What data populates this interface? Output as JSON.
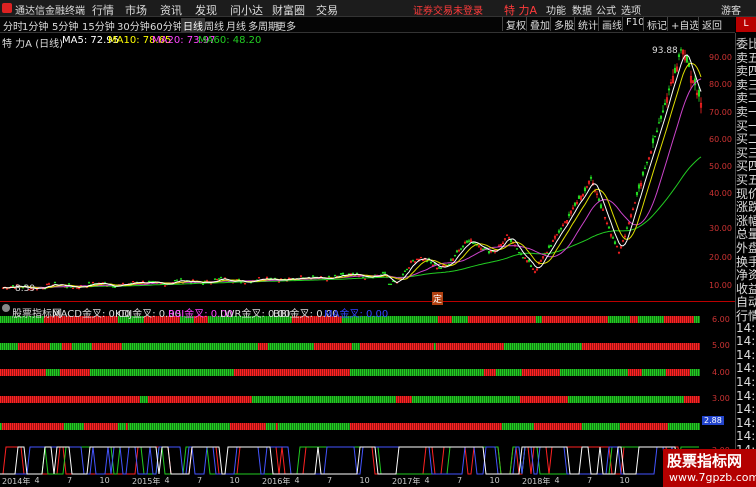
{
  "titlebar": {
    "app_name": "通达信金融终端",
    "menus": [
      "行情",
      "市场",
      "资讯",
      "发现",
      "问小达",
      "财富圈",
      "交易"
    ],
    "login_status": "证券交易未登录",
    "stock_name": "特 力A",
    "right_menus": [
      "功能",
      "数据",
      "公式",
      "选项"
    ],
    "user": "游客"
  },
  "toolbar": {
    "periods": [
      "分时",
      "1分钟",
      "5分钟",
      "15分钟",
      "30分钟",
      "60分钟",
      "日线",
      "周线",
      "月线",
      "多周期",
      "更多"
    ],
    "active_period": "日线",
    "right_buttons": [
      "复权",
      "叠加",
      "多股",
      "统计",
      "画线",
      "F10",
      "标记",
      "+自选",
      "返回"
    ]
  },
  "main_chart": {
    "stock_label": "特 力A (日线)",
    "ma_labels": [
      {
        "text": "MA5: 72.95",
        "color": "#ffffff"
      },
      {
        "text": "MA10: 78.65",
        "color": "#ffff00"
      },
      {
        "text": "MA20: 73.97",
        "color": "#ff44ff"
      },
      {
        "text": "MA60: 48.20",
        "color": "#22cc22"
      }
    ],
    "high_label": "93.88",
    "low_label": "8.39",
    "marker": "定",
    "axis_ticks": [
      "90.00",
      "80.00",
      "70.00",
      "60.00",
      "50.00",
      "40.00",
      "30.00",
      "20.00",
      "10.00"
    ]
  },
  "indicator_panel": {
    "title": "股票指标网",
    "labels": [
      {
        "text": "MACD金叉: 0.00",
        "color": "#dddddd"
      },
      {
        "text": "KDJ金叉: 0.00",
        "color": "#dddddd"
      },
      {
        "text": "RSI金叉: 0.00",
        "color": "#ff44ff"
      },
      {
        "text": "LWR金叉: 0.00",
        "color": "#dddddd"
      },
      {
        "text": "BBI金叉: 0.00",
        "color": "#dddddd"
      },
      {
        "text": "MA金叉: 0.00",
        "color": "#3344ff"
      }
    ],
    "axis_ticks": [
      "6.00",
      "5.00",
      "4.00",
      "3.00",
      "2.00"
    ],
    "current_value": "2.88"
  },
  "side_panel": {
    "items": [
      "委比",
      "卖五",
      "卖四",
      "卖三",
      "卖二",
      "卖一",
      "买一",
      "买二",
      "买三",
      "买四",
      "买五",
      "现价",
      "涨跌",
      "涨幅",
      "总量",
      "外盘",
      "换手",
      "净资",
      "收益",
      "自动",
      "行情",
      "14:5",
      "14:5",
      "14:5",
      "14:5",
      "14:5",
      "14:5",
      "14:5",
      "14:5",
      "14:5",
      "14:5",
      "14:5"
    ]
  },
  "date_axis": {
    "labels": [
      "2014年",
      "4",
      "7",
      "10",
      "2015年",
      "4",
      "7",
      "10",
      "2016年",
      "4",
      "7",
      "10",
      "2017年",
      "4",
      "7",
      "10",
      "2018年",
      "4",
      "7",
      "10"
    ]
  },
  "watermark": {
    "title": "股票指标网",
    "url": "www.7gpzb.com"
  },
  "colors": {
    "up": "#ff2222",
    "down": "#22dd22",
    "axis": "#cc3333",
    "background": "#000000"
  }
}
